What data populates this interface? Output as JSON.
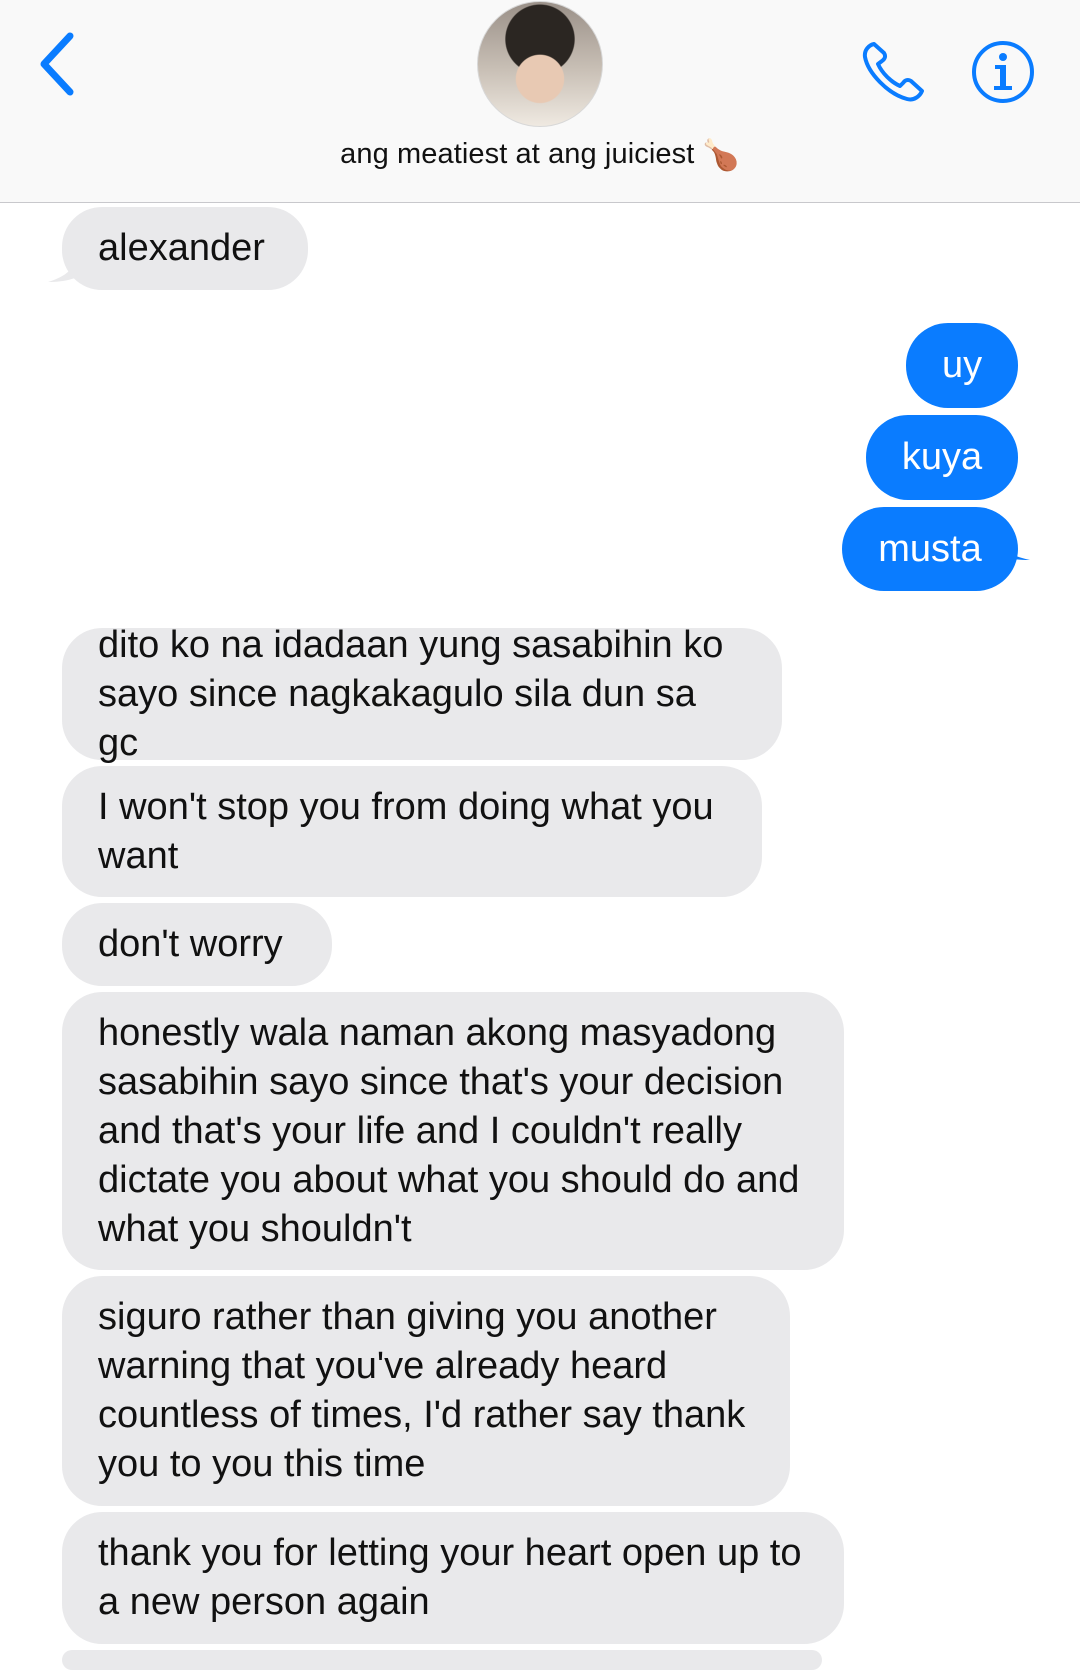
{
  "header": {
    "contact_name": "ang meatiest at ang juiciest",
    "contact_emoji": "🍗",
    "back_icon": "chevron-left-icon",
    "call_icon": "phone-icon",
    "info_icon": "info-icon",
    "accent_color": "#0a7cff"
  },
  "messages": [
    {
      "from": "them",
      "text": "alexander"
    },
    {
      "from": "me",
      "text": "uy"
    },
    {
      "from": "me",
      "text": "kuya"
    },
    {
      "from": "me",
      "text": "musta"
    },
    {
      "from": "them",
      "text": "dito ko na idadaan yung sasabihin ko sayo since nagkakagulo sila dun sa gc"
    },
    {
      "from": "them",
      "text": "I won't stop you from doing what you want"
    },
    {
      "from": "them",
      "text": "don't worry"
    },
    {
      "from": "them",
      "text": "honestly wala naman akong masyadong sasabihin sayo since that's your decision and that's your life and I couldn't really dictate you about what you should do and what you shouldn't"
    },
    {
      "from": "them",
      "text": "siguro rather than giving you another warning that you've already heard countless of times, I'd rather say thank you to you this time"
    },
    {
      "from": "them",
      "text": "thank you for letting your heart open up to a new person again"
    }
  ],
  "colors": {
    "incoming_bubble": "#e9e9eb",
    "outgoing_bubble": "#0a7cff"
  }
}
